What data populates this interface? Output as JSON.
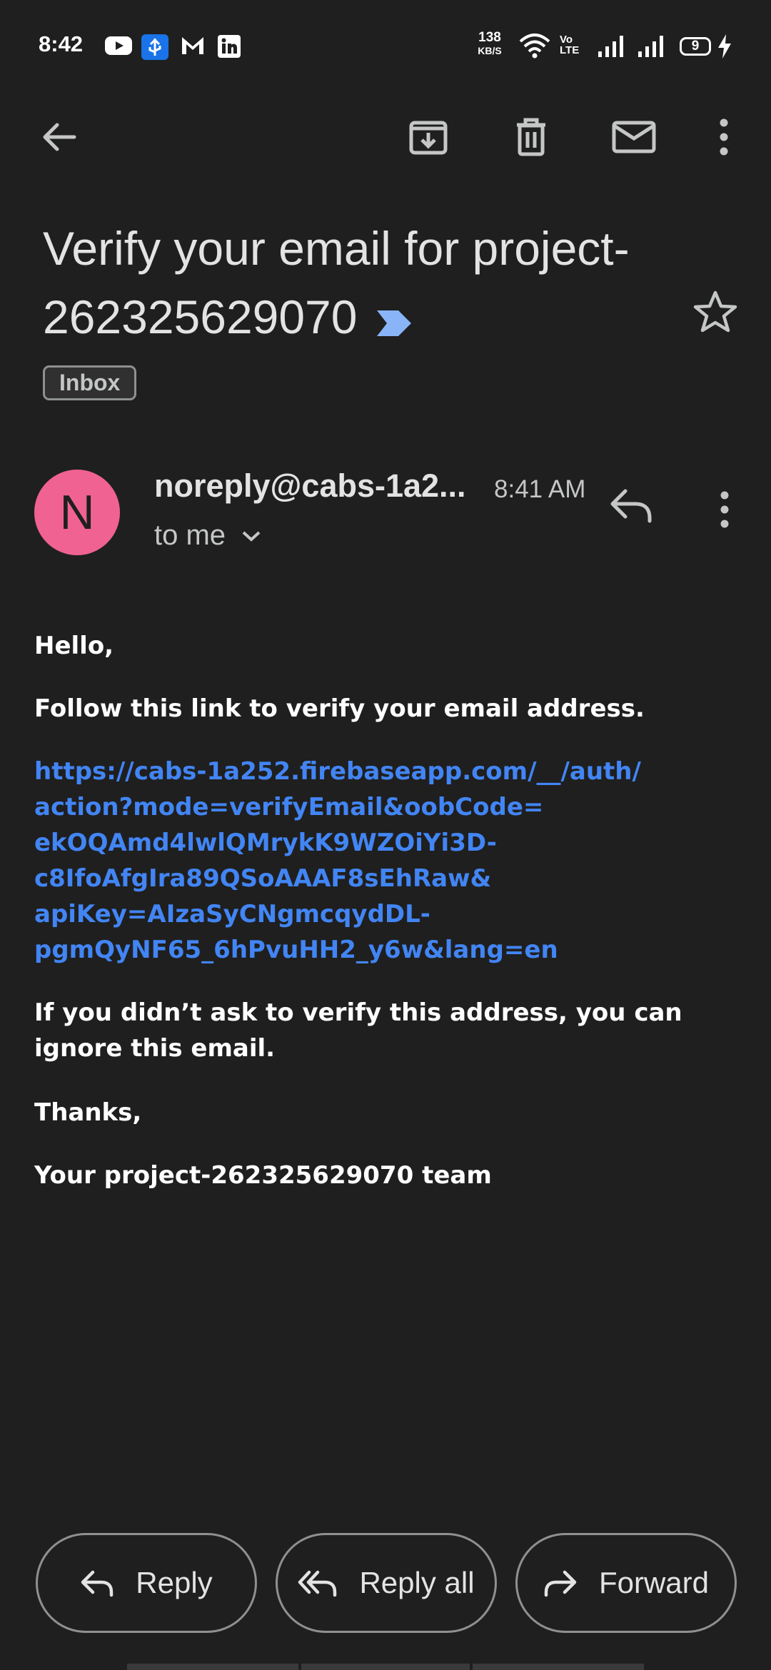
{
  "status_bar": {
    "time": "8:42",
    "net_speed_value": "138",
    "net_speed_unit": "KB/S",
    "volte_top": "Vo",
    "volte_bottom": "LTE",
    "battery_level": "9",
    "notification_icons": [
      "youtube-icon",
      "usb-debug-icon",
      "gmail-icon",
      "linkedin-icon"
    ]
  },
  "toolbar": {
    "icons": [
      "back-arrow-icon",
      "archive-icon",
      "delete-icon",
      "mark-unread-icon",
      "more-vert-icon"
    ]
  },
  "email": {
    "subject": "Verify your email for project-262325629070",
    "label": "Inbox",
    "sender": "noreply@cabs-1a2...",
    "avatar_letter": "N",
    "avatar_color": "#f06292",
    "time": "8:41 AM",
    "recipient": "to me",
    "body": {
      "greeting": "Hello,",
      "instruction": "Follow this link to verify your email address.",
      "link": "https://cabs-1a252.firebaseapp.com/__/auth/\naction?mode=verifyEmail&oobCode=\nekOQAmd4lwlQMrykK9WZOiYi3D-\nc8IfoAfgIra89QSoAAAF8sEhRaw&\napiKey=AIzaSyCNgmcqydDL-\npgmQyNF65_6hPvuHH2_y6w&lang=en",
      "disclaimer": "If you didn’t ask to verify this address, you can ignore this email.",
      "thanks": "Thanks,",
      "signature": "Your project-262325629070 team"
    }
  },
  "actions": {
    "reply": "Reply",
    "reply_all": "Reply all",
    "forward": "Forward"
  },
  "colors": {
    "background": "#1f1f1f",
    "link": "#4285f4",
    "importance": "#8ab4f8"
  }
}
